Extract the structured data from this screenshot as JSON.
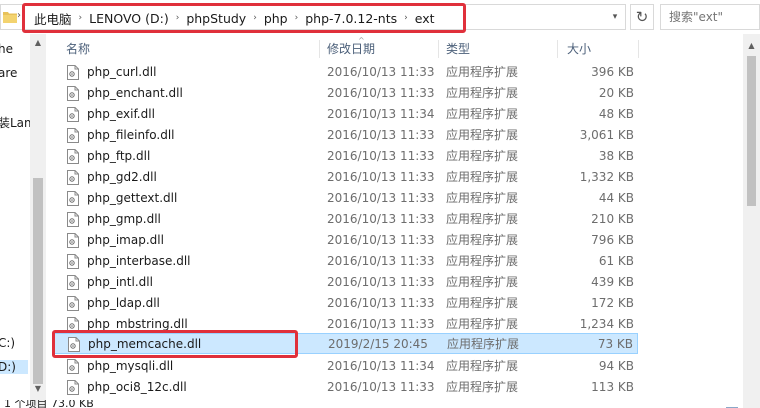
{
  "address": {
    "crumbs": [
      "此电脑",
      "LENOVO (D:)",
      "phpStudy",
      "php",
      "php-7.0.12-nts",
      "ext"
    ],
    "search_placeholder": "搜索\"ext\""
  },
  "nav": {
    "items": [
      "he",
      "are",
      "装Lam",
      "C:)",
      "D:)"
    ]
  },
  "columns": {
    "name": "名称",
    "date": "修改日期",
    "type": "类型",
    "size": "大小"
  },
  "files": [
    {
      "name": "php_curl.dll",
      "date": "2016/10/13 11:33",
      "type": "应用程序扩展",
      "size": "396 KB"
    },
    {
      "name": "php_enchant.dll",
      "date": "2016/10/13 11:33",
      "type": "应用程序扩展",
      "size": "20 KB"
    },
    {
      "name": "php_exif.dll",
      "date": "2016/10/13 11:34",
      "type": "应用程序扩展",
      "size": "48 KB"
    },
    {
      "name": "php_fileinfo.dll",
      "date": "2016/10/13 11:33",
      "type": "应用程序扩展",
      "size": "3,061 KB"
    },
    {
      "name": "php_ftp.dll",
      "date": "2016/10/13 11:33",
      "type": "应用程序扩展",
      "size": "38 KB"
    },
    {
      "name": "php_gd2.dll",
      "date": "2016/10/13 11:33",
      "type": "应用程序扩展",
      "size": "1,332 KB"
    },
    {
      "name": "php_gettext.dll",
      "date": "2016/10/13 11:33",
      "type": "应用程序扩展",
      "size": "44 KB"
    },
    {
      "name": "php_gmp.dll",
      "date": "2016/10/13 11:33",
      "type": "应用程序扩展",
      "size": "210 KB"
    },
    {
      "name": "php_imap.dll",
      "date": "2016/10/13 11:33",
      "type": "应用程序扩展",
      "size": "796 KB"
    },
    {
      "name": "php_interbase.dll",
      "date": "2016/10/13 11:33",
      "type": "应用程序扩展",
      "size": "61 KB"
    },
    {
      "name": "php_intl.dll",
      "date": "2016/10/13 11:33",
      "type": "应用程序扩展",
      "size": "439 KB"
    },
    {
      "name": "php_ldap.dll",
      "date": "2016/10/13 11:33",
      "type": "应用程序扩展",
      "size": "172 KB"
    },
    {
      "name": "php_mbstring.dll",
      "date": "2016/10/13 11:33",
      "type": "应用程序扩展",
      "size": "1,234 KB"
    },
    {
      "name": "php_memcache.dll",
      "date": "2019/2/15 20:45",
      "type": "应用程序扩展",
      "size": "73 KB",
      "selected": true
    },
    {
      "name": "php_mysqli.dll",
      "date": "2016/10/13 11:34",
      "type": "应用程序扩展",
      "size": "94 KB"
    },
    {
      "name": "php_oci8_12c.dll",
      "date": "2016/10/13 11:33",
      "type": "应用程序扩展",
      "size": "113 KB"
    }
  ],
  "status": {
    "text": "1 个项目    73.0 KB"
  },
  "colors": {
    "highlight_box": "#e0303b",
    "selected_row": "#cce8ff",
    "header_text": "#4c607a"
  }
}
